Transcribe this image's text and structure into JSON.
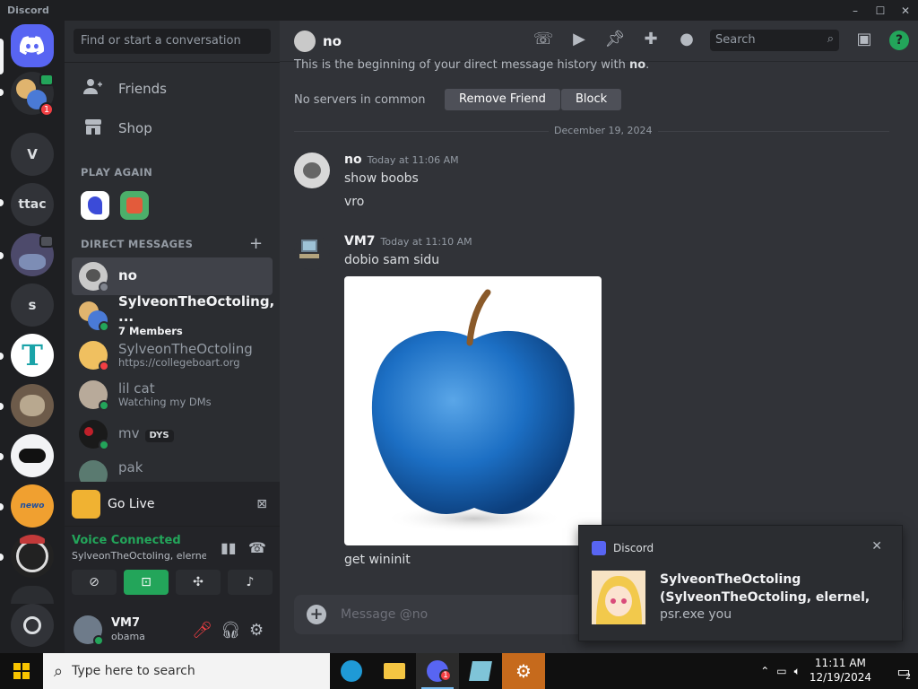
{
  "window": {
    "title": "Discord",
    "controls": [
      "–",
      "☐",
      "✕"
    ]
  },
  "guilds": [
    {
      "label": "",
      "kind": "home"
    },
    {
      "label": "",
      "kind": "group",
      "badge": "1"
    },
    {
      "label": "V"
    },
    {
      "label": "ttac"
    },
    {
      "label": ""
    },
    {
      "label": "s"
    },
    {
      "label": "T"
    },
    {
      "label": ""
    },
    {
      "label": ""
    },
    {
      "label": ""
    },
    {
      "label": ""
    }
  ],
  "sidebar": {
    "search_placeholder": "Find or start a conversation",
    "nav": [
      {
        "label": "Friends"
      },
      {
        "label": "Shop"
      }
    ],
    "play_again_title": "PLAY AGAIN",
    "dm_title": "DIRECT MESSAGES",
    "dm_add": "+",
    "dms": [
      {
        "name": "no",
        "sub": ""
      },
      {
        "name": "SylveonTheOctoling, ...",
        "sub": "7 Members"
      },
      {
        "name": "SylveonTheOctoling",
        "sub": "https://collegeboart.org"
      },
      {
        "name": "lil cat",
        "sub": "Watching my DMs"
      },
      {
        "name": "mv",
        "sub": "",
        "tag": "DYS"
      },
      {
        "name": "pak",
        "sub": ""
      }
    ],
    "go_live": "Go Live",
    "voice": {
      "status": "Voice Connected",
      "channel": "SylveonTheOctoling, elerne..."
    },
    "user": {
      "name": "VM7",
      "status": "obama"
    }
  },
  "header": {
    "name": "no",
    "search_placeholder": "Search",
    "help": "?"
  },
  "chat": {
    "beginning": "This is the beginning of your direct message history with ",
    "beginning_name": "no",
    "no_common": "No servers in common",
    "remove_friend": "Remove Friend",
    "block": "Block",
    "date": "December 19, 2024",
    "messages": [
      {
        "author": "no",
        "time": "Today at 11:06 AM",
        "lines": [
          "show boobs",
          "vro"
        ]
      },
      {
        "author": "VM7",
        "time": "Today at 11:10 AM",
        "lines": [
          "dobio sam sidu",
          "get wininit"
        ]
      }
    ],
    "composer_placeholder": "Message @no"
  },
  "toast": {
    "app": "Discord",
    "close": "✕",
    "title": "SylveonTheOctoling (SylveonTheOctoling, elernel, dingus©",
    "body": "psr.exe you"
  },
  "taskbar": {
    "search_placeholder": "Type here to search",
    "time": "11:11 AM",
    "date": "12/19/2024",
    "discord_badge": "1",
    "notif_count": "2"
  },
  "colors": {
    "blurple": "#5865f2",
    "green": "#23a55a",
    "red": "#f23f43",
    "bg": "#313338"
  }
}
